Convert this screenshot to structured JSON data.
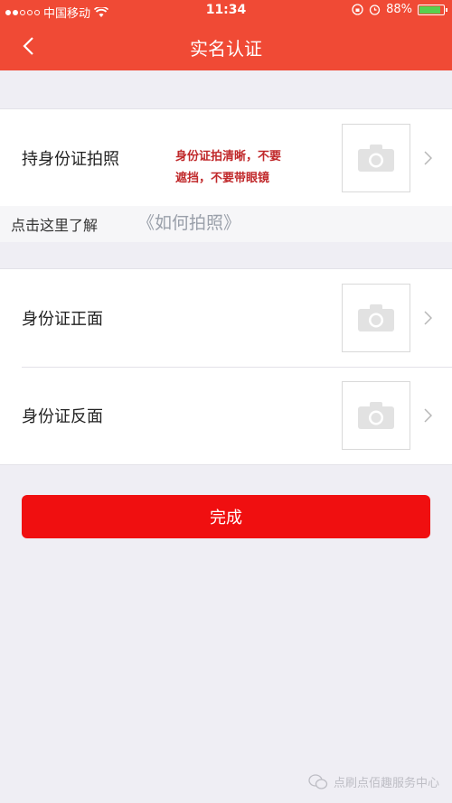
{
  "status_bar": {
    "carrier": "中国移动",
    "time": "11:34",
    "battery": "88%",
    "battery_level": 0.88
  },
  "nav": {
    "title": "实名认证",
    "back_icon": "chevron-left-icon"
  },
  "holding_photo": {
    "label": "持身份证拍照",
    "hint_line1": "身份证拍清晰，不要",
    "hint_line2": "遮挡，不要带眼镜"
  },
  "howto": {
    "lead": "点击这里了解",
    "link": "《如何拍照》"
  },
  "id_front": {
    "label": "身份证正面"
  },
  "id_back": {
    "label": "身份证反面"
  },
  "done_button": {
    "label": "完成"
  },
  "watermark": {
    "text": "点刷点佰趣服务中心"
  },
  "colors": {
    "header": "#f04a35",
    "button": "#f00f10",
    "hint": "#c0282a",
    "background": "#efeef4"
  }
}
